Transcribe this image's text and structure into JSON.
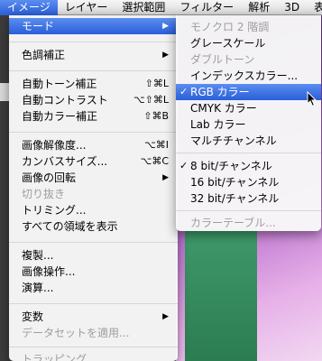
{
  "menubar": {
    "items": [
      {
        "label": "イメージ",
        "active": true
      },
      {
        "label": "レイヤー"
      },
      {
        "label": "選択範囲"
      },
      {
        "label": "フィルター"
      },
      {
        "label": "解析"
      },
      {
        "label": "3D"
      },
      {
        "label": "表"
      }
    ]
  },
  "image_menu": {
    "mode": "モード",
    "adjustments": "色調補正",
    "auto_tone": "自動トーン補正",
    "auto_tone_shortcut": "⇧⌘L",
    "auto_contrast": "自動コントラスト",
    "auto_contrast_shortcut": "⌥⇧⌘L",
    "auto_color": "自動カラー補正",
    "auto_color_shortcut": "⇧⌘B",
    "image_size": "画像解像度...",
    "image_size_shortcut": "⌥⌘I",
    "canvas_size": "カンバスサイズ...",
    "canvas_size_shortcut": "⌥⌘C",
    "rotation": "画像の回転",
    "crop": "切り抜き",
    "trim": "トリミング...",
    "reveal_all": "すべての領域を表示",
    "duplicate": "複製...",
    "apply_image": "画像操作...",
    "calculations": "演算...",
    "variables": "変数",
    "apply_data_set": "データセットを適用...",
    "trap": "トラッピング..."
  },
  "mode_submenu": {
    "bitmap": "モノクロ 2 階調",
    "grayscale": "グレースケール",
    "duotone": "ダブルトーン",
    "indexed": "インデックスカラー...",
    "rgb": "RGB カラー",
    "rgb_check": "✓",
    "cmyk": "CMYK カラー",
    "lab": "Lab カラー",
    "multichannel": "マルチチャンネル",
    "bit8": "8 bit/チャンネル",
    "bit8_check": "✓",
    "bit16": "16 bit/チャンネル",
    "bit32": "32 bit/チャンネル",
    "color_table": "カラーテーブル..."
  },
  "colors": {
    "highlight": "#2a5fd8",
    "disabled_text": "#9d9d9d"
  }
}
